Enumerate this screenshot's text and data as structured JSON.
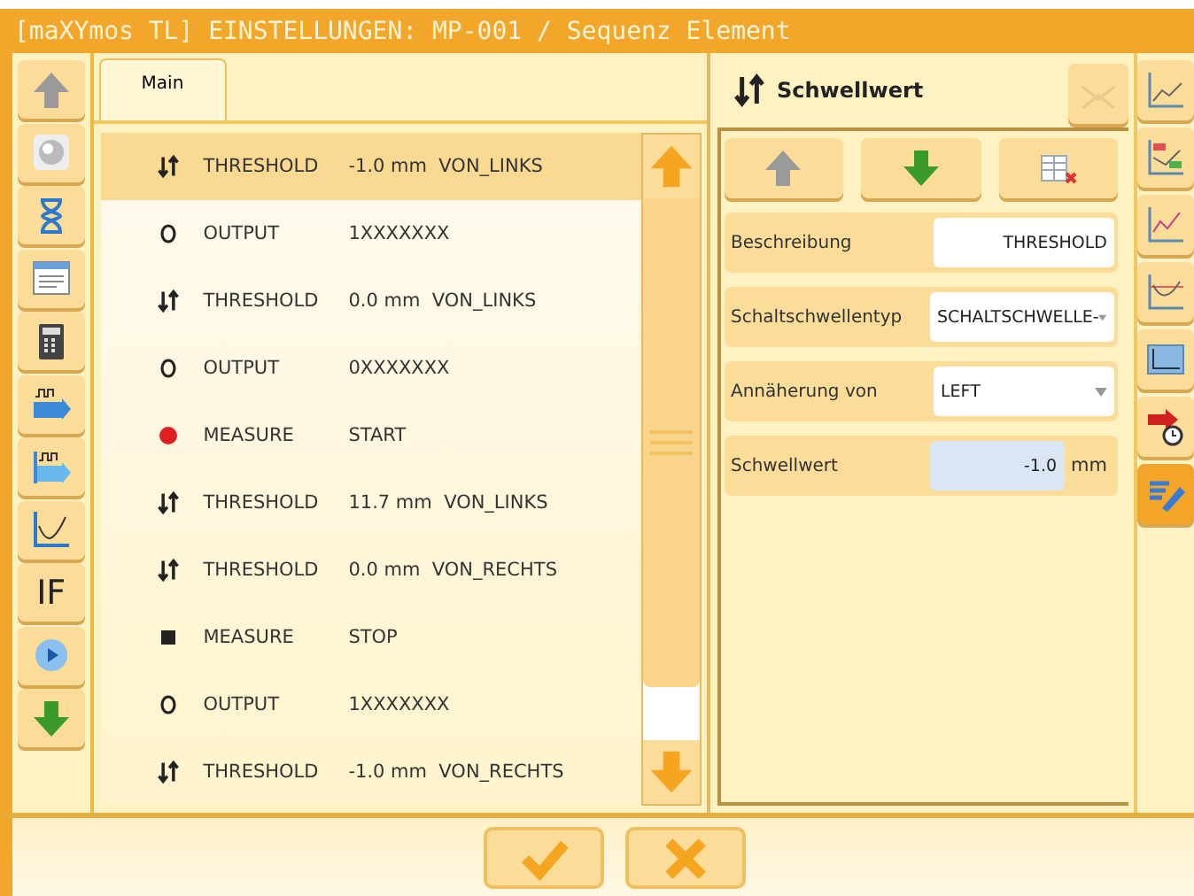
{
  "window": {
    "title": "[maXYmos TL] EINSTELLUNGEN: MP-001 / Sequenz Element"
  },
  "tabs": [
    {
      "label": "Main",
      "selected": true
    }
  ],
  "left_toolbar": [
    {
      "kind": "up"
    },
    {
      "kind": "sphere"
    },
    {
      "kind": "hourglass"
    },
    {
      "kind": "window"
    },
    {
      "kind": "calculator"
    },
    {
      "kind": "signal_in"
    },
    {
      "kind": "signal_out"
    },
    {
      "kind": "chart"
    },
    {
      "kind": "text",
      "label": "IF"
    },
    {
      "kind": "play"
    },
    {
      "kind": "down"
    }
  ],
  "elements": [
    {
      "kind": "threshold",
      "type": "THRESHOLD",
      "value": "-1.0 mm  VON_LINKS",
      "selected": true
    },
    {
      "kind": "output",
      "type": "OUTPUT",
      "value": "1XXXXXXX",
      "selected": false
    },
    {
      "kind": "threshold",
      "type": "THRESHOLD",
      "value": "0.0 mm  VON_LINKS",
      "selected": false
    },
    {
      "kind": "output",
      "type": "OUTPUT",
      "value": "0XXXXXXX",
      "selected": false
    },
    {
      "kind": "start",
      "type": "MEASURE",
      "value": "START",
      "selected": false
    },
    {
      "kind": "threshold",
      "type": "THRESHOLD",
      "value": "11.7 mm  VON_LINKS",
      "selected": false
    },
    {
      "kind": "threshold",
      "type": "THRESHOLD",
      "value": "0.0 mm  VON_RECHTS",
      "selected": false
    },
    {
      "kind": "stop",
      "type": "MEASURE",
      "value": "STOP",
      "selected": false
    },
    {
      "kind": "output",
      "type": "OUTPUT",
      "value": "1XXXXXXX",
      "selected": false
    },
    {
      "kind": "threshold",
      "type": "THRESHOLD",
      "value": "-1.0 mm  VON_RECHTS",
      "selected": false
    }
  ],
  "detail": {
    "title": "Schwellwert",
    "fields": [
      {
        "kind": "text",
        "label": "Beschreibung",
        "value": "THRESHOLD"
      },
      {
        "kind": "select",
        "label": "Schaltschwellentyp",
        "value": "SCHALTSCHWELLE-"
      },
      {
        "kind": "select",
        "label": "Annäherung von",
        "value": "LEFT"
      },
      {
        "kind": "number",
        "label": "Schwellwert",
        "value": "-1.0",
        "unit": "mm"
      }
    ]
  },
  "right_toolbar": [
    {
      "kind": "chart",
      "selected": false
    },
    {
      "kind": "chart_box",
      "selected": false
    },
    {
      "kind": "chart_rise",
      "selected": false
    },
    {
      "kind": "chart_curve",
      "selected": false
    },
    {
      "kind": "screen",
      "selected": false
    },
    {
      "kind": "timer",
      "selected": false
    },
    {
      "kind": "edit",
      "selected": true
    }
  ]
}
